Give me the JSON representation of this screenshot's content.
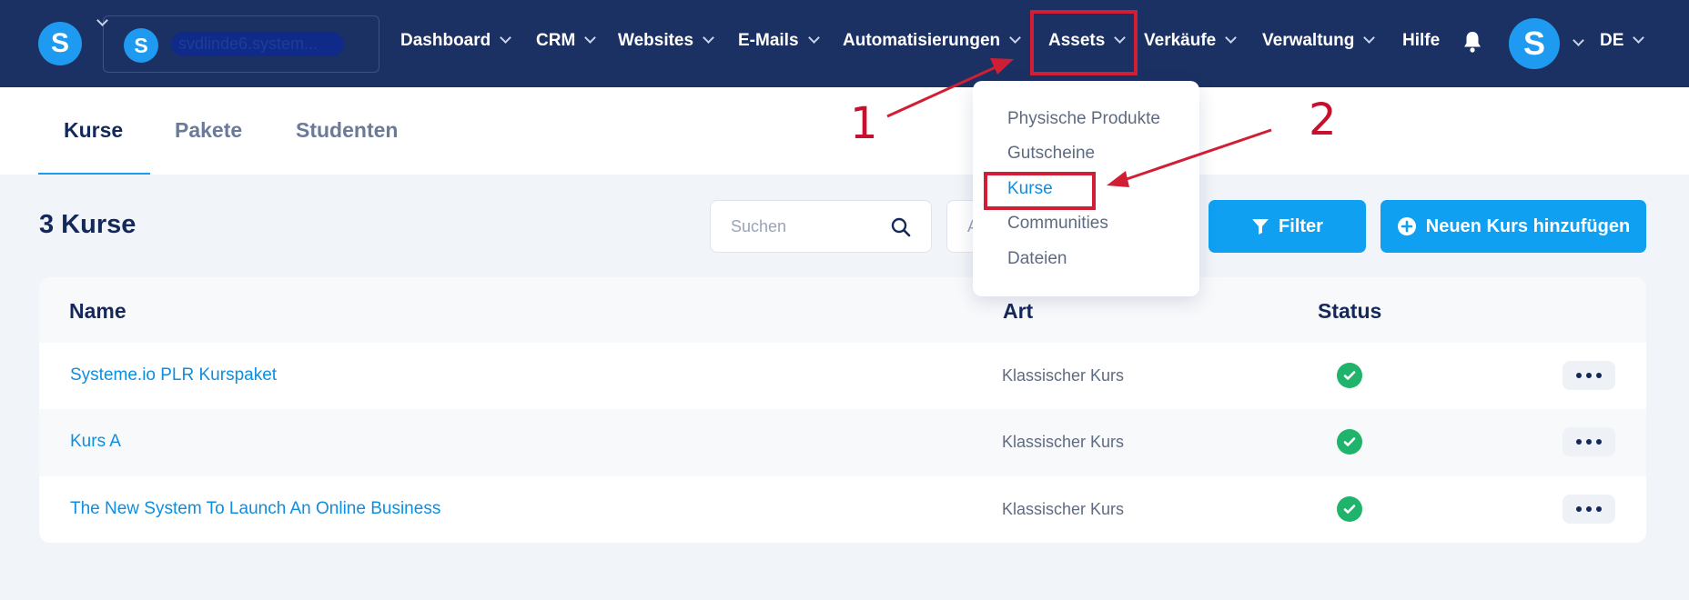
{
  "header": {
    "account_name": "svdlinde6.system...",
    "nav": [
      {
        "label": "Dashboard"
      },
      {
        "label": "CRM"
      },
      {
        "label": "Websites"
      },
      {
        "label": "E-Mails"
      },
      {
        "label": "Automatisierungen"
      },
      {
        "label": "Assets"
      },
      {
        "label": "Verkäufe"
      },
      {
        "label": "Verwaltung"
      },
      {
        "label": "Hilfe"
      }
    ],
    "logo_letter": "S",
    "avatar_letter": "S",
    "language": "DE"
  },
  "tabs": [
    {
      "label": "Kurse",
      "active": true
    },
    {
      "label": "Pakete"
    },
    {
      "label": "Studenten"
    }
  ],
  "toolbar": {
    "title": "3 Kurse",
    "search_placeholder": "Suchen",
    "select_partial": "A",
    "filter_label": "Filter",
    "add_label": "Neuen Kurs hinzufügen"
  },
  "table": {
    "columns": [
      "Name",
      "Art",
      "Status"
    ],
    "rows": [
      {
        "name": "Systeme.io PLR Kurspaket",
        "art": "Klassischer Kurs",
        "status": "active"
      },
      {
        "name": "Kurs A",
        "art": "Klassischer Kurs",
        "status": "active"
      },
      {
        "name": "The New System To Launch An Online Business",
        "art": "Klassischer Kurs",
        "status": "active"
      }
    ]
  },
  "assets_menu": {
    "items": [
      {
        "label": "Physische Produkte"
      },
      {
        "label": "Gutscheine"
      },
      {
        "label": "Kurse",
        "active": true
      },
      {
        "label": "Communities"
      },
      {
        "label": "Dateien"
      }
    ]
  },
  "annotations": {
    "step1": "1",
    "step2": "2",
    "color": "#d01f35"
  },
  "colors": {
    "navbar": "#1c3163",
    "accent": "#0fa0f2",
    "link": "#0e8ee0",
    "status_ok": "#1fb36b"
  }
}
